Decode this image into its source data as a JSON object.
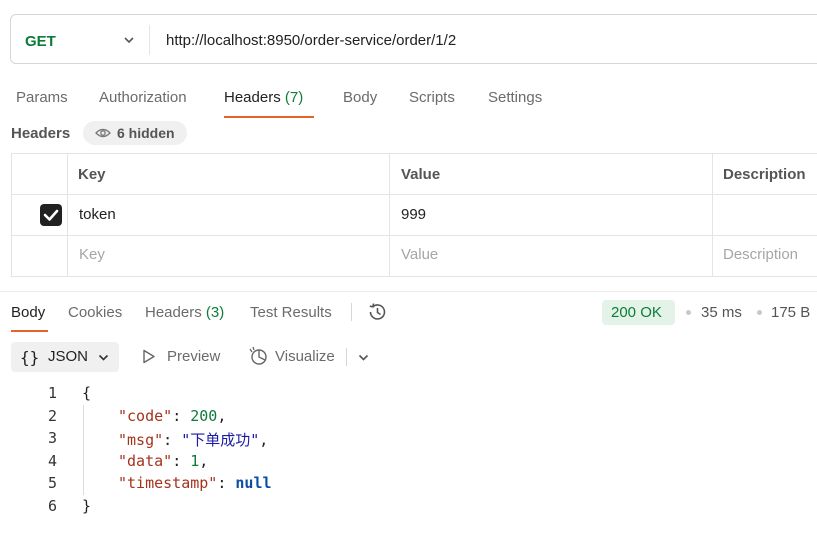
{
  "request": {
    "method": "GET",
    "url": "http://localhost:8950/order-service/order/1/2"
  },
  "request_tabs": {
    "params": "Params",
    "authorization": "Authorization",
    "headers_label": "Headers",
    "headers_count": "(7)",
    "body": "Body",
    "scripts": "Scripts",
    "settings": "Settings"
  },
  "headers_section": {
    "title": "Headers",
    "hidden": "6 hidden"
  },
  "headers_table": {
    "columns": [
      "Key",
      "Value",
      "Description"
    ],
    "rows": [
      {
        "checked": true,
        "key": "token",
        "value": "999",
        "description": ""
      }
    ],
    "placeholder": {
      "key": "Key",
      "value": "Value",
      "description": "Description"
    }
  },
  "response_tabs": {
    "body": "Body",
    "cookies": "Cookies",
    "headers_label": "Headers",
    "headers_count": "(3)",
    "test_results": "Test Results"
  },
  "response_meta": {
    "status": "200 OK",
    "time": "35 ms",
    "size": "175 B"
  },
  "view_toolbar": {
    "format": "JSON",
    "preview": "Preview",
    "visualize": "Visualize"
  },
  "response_body": {
    "line_numbers": [
      "1",
      "2",
      "3",
      "4",
      "5",
      "6"
    ],
    "open_brace": "{",
    "close_brace": "}",
    "fields": [
      {
        "key": "\"code\"",
        "value": "200",
        "suffix": ","
      },
      {
        "key": "\"msg\"",
        "value": "\"下单成功\"",
        "suffix": ","
      },
      {
        "key": "\"data\"",
        "value": "1",
        "suffix": ","
      },
      {
        "key": "\"timestamp\"",
        "value": "null",
        "suffix": ""
      }
    ]
  },
  "colors": {
    "accent": "#e8632b",
    "method_green": "#0f7b3a",
    "status_bg": "#e3f3e8",
    "json_key": "#a5331e",
    "json_string": "#1a1aa6",
    "json_number": "#0f7b3a",
    "json_null": "#0a4fa6"
  }
}
